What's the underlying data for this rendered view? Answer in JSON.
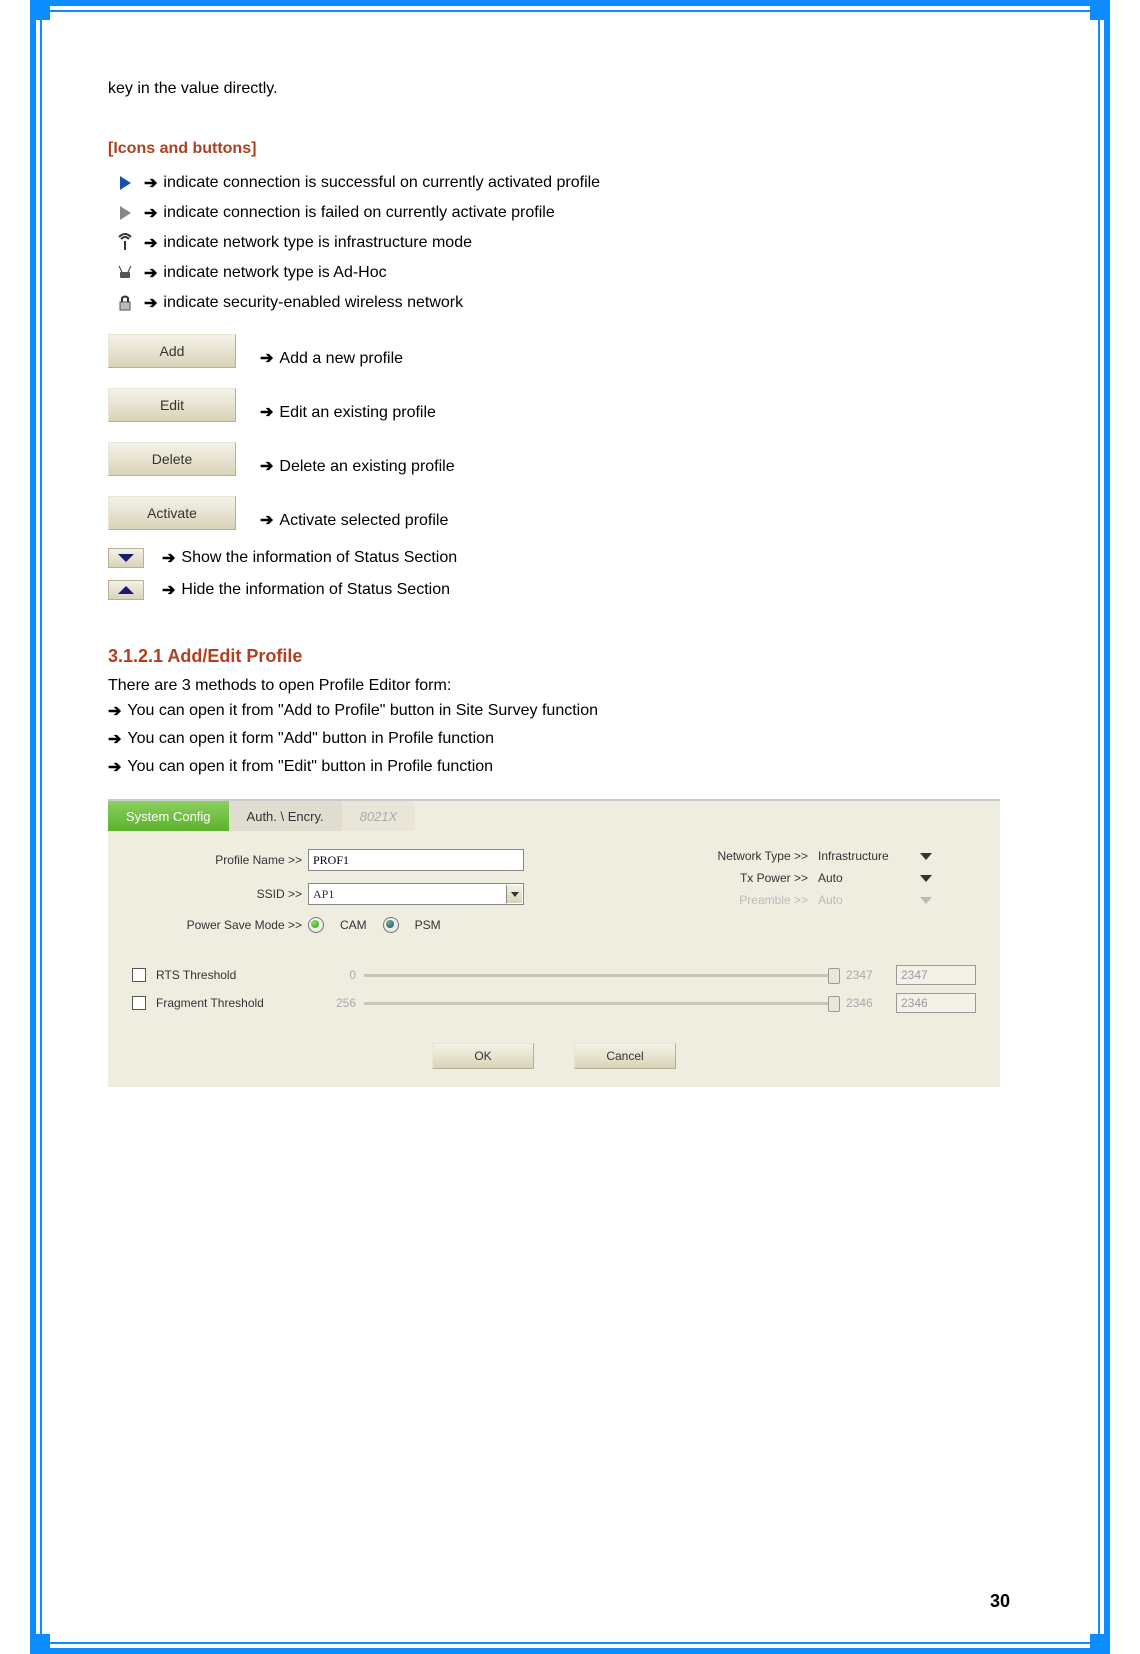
{
  "top_note": "key in the value directly.",
  "icons_heading": "[Icons and buttons]",
  "legend": {
    "success": "indicate connection is successful on currently activated profile",
    "failed": "indicate connection is failed on currently activate profile",
    "infra": "indicate network type is infrastructure mode",
    "adhoc": "indicate network type is Ad-Hoc",
    "secure": "indicate security-enabled wireless network"
  },
  "buttons": {
    "add": {
      "label": "Add",
      "desc": "Add a new profile"
    },
    "edit": {
      "label": "Edit",
      "desc": "Edit an existing profile"
    },
    "delete": {
      "label": "Delete",
      "desc": "Delete an existing profile"
    },
    "activate": {
      "label": "Activate",
      "desc": "Activate selected profile"
    }
  },
  "toggle": {
    "show": "Show the information of Status Section",
    "hide": "Hide the information of Status Section"
  },
  "subsection": {
    "heading": "3.1.2.1 Add/Edit Profile",
    "intro": "There are 3 methods to open Profile Editor form:",
    "method1": "You can open it from \"Add to Profile\" button in Site Survey function",
    "method2": "You can open it form \"Add\" button in Profile function",
    "method3": "You can open it from \"Edit\" button in Profile function"
  },
  "editor": {
    "tabs": {
      "system": "System Config",
      "auth": "Auth. \\ Encry.",
      "dot1x": "8021X"
    },
    "labels": {
      "profile_name": "Profile Name >>",
      "ssid": "SSID >>",
      "psm": "Power Save Mode >>",
      "network_type": "Network Type >>",
      "tx_power": "Tx Power >>",
      "preamble": "Preamble >>",
      "rts": "RTS Threshold",
      "frag": "Fragment Threshold",
      "cam": "CAM",
      "psm_radio": "PSM"
    },
    "values": {
      "profile_name": "PROF1",
      "ssid": "AP1",
      "network_type": "Infrastructure",
      "tx_power": "Auto",
      "preamble": "Auto",
      "rts_min": "0",
      "rts_max": "2347",
      "rts_val": "2347",
      "frag_min": "256",
      "frag_max": "2346",
      "frag_val": "2346"
    },
    "actions": {
      "ok": "OK",
      "cancel": "Cancel"
    }
  },
  "page_number": "30",
  "glyphs": {
    "arrow": "➔"
  }
}
